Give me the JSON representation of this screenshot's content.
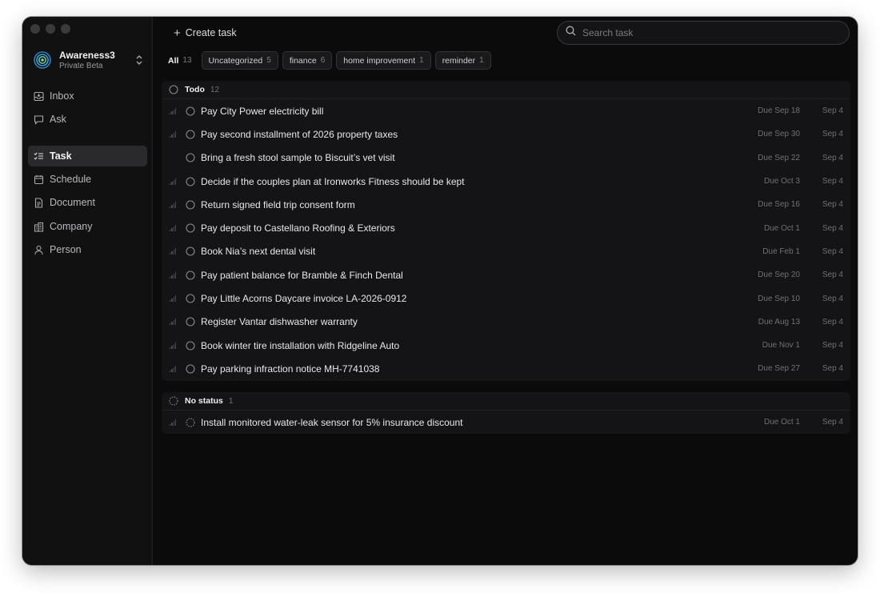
{
  "workspace": {
    "name": "Awareness3",
    "subtitle": "Private Beta"
  },
  "nav": [
    {
      "label": "Inbox",
      "icon": "inbox-icon"
    },
    {
      "label": "Ask",
      "icon": "chat-icon"
    },
    {
      "label": "Task",
      "icon": "checklist-icon",
      "active": true
    },
    {
      "label": "Schedule",
      "icon": "calendar-icon"
    },
    {
      "label": "Document",
      "icon": "document-icon"
    },
    {
      "label": "Company",
      "icon": "building-icon"
    },
    {
      "label": "Person",
      "icon": "person-icon"
    }
  ],
  "toolbar": {
    "create_label": "Create task",
    "search_placeholder": "Search task"
  },
  "filters": [
    {
      "label": "All",
      "count": "13",
      "active": true
    },
    {
      "label": "Uncategorized",
      "count": "5"
    },
    {
      "label": "finance",
      "count": "6"
    },
    {
      "label": "home improvement",
      "count": "1"
    },
    {
      "label": "reminder",
      "count": "1"
    }
  ],
  "groups": [
    {
      "label": "Todo",
      "count": "12",
      "status": "todo",
      "tasks": [
        {
          "title": "Pay City Power electricity bill",
          "due": "Due Sep 18",
          "created": "Sep 4",
          "priority": true
        },
        {
          "title": "Pay second installment of 2026 property taxes",
          "due": "Due Sep 30",
          "created": "Sep 4",
          "priority": true
        },
        {
          "title": "Bring a fresh stool sample to Biscuit’s vet visit",
          "due": "Due Sep 22",
          "created": "Sep 4",
          "priority": false
        },
        {
          "title": "Decide if the couples plan at Ironworks Fitness should be kept",
          "due": "Due Oct 3",
          "created": "Sep 4",
          "priority": true
        },
        {
          "title": "Return signed field trip consent form",
          "due": "Due Sep 16",
          "created": "Sep 4",
          "priority": true
        },
        {
          "title": "Pay deposit to Castellano Roofing & Exteriors",
          "due": "Due Oct 1",
          "created": "Sep 4",
          "priority": true
        },
        {
          "title": "Book Nia’s next dental visit",
          "due": "Due Feb 1",
          "created": "Sep 4",
          "priority": true
        },
        {
          "title": "Pay patient balance for Bramble & Finch Dental",
          "due": "Due Sep 20",
          "created": "Sep 4",
          "priority": true
        },
        {
          "title": "Pay Little Acorns Daycare invoice LA-2026-0912",
          "due": "Due Sep 10",
          "created": "Sep 4",
          "priority": true
        },
        {
          "title": "Register Vantar dishwasher warranty",
          "due": "Due Aug 13",
          "created": "Sep 4",
          "priority": true
        },
        {
          "title": "Book winter tire installation with Ridgeline Auto",
          "due": "Due Nov 1",
          "created": "Sep 4",
          "priority": true
        },
        {
          "title": "Pay parking infraction notice MH-7741038",
          "due": "Due Sep 27",
          "created": "Sep 4",
          "priority": true
        }
      ]
    },
    {
      "label": "No status",
      "count": "1",
      "status": "none",
      "tasks": [
        {
          "title": "Install monitored water-leak sensor for 5% insurance discount",
          "due": "Due Oct 1",
          "created": "Sep 4",
          "priority": true
        }
      ]
    }
  ],
  "colors": {
    "window": "#0b0b0c",
    "sidebar": "#111112",
    "group": "#141416",
    "text": "#e8e8ea",
    "muted": "#707075",
    "accent": "#3b82c4"
  }
}
